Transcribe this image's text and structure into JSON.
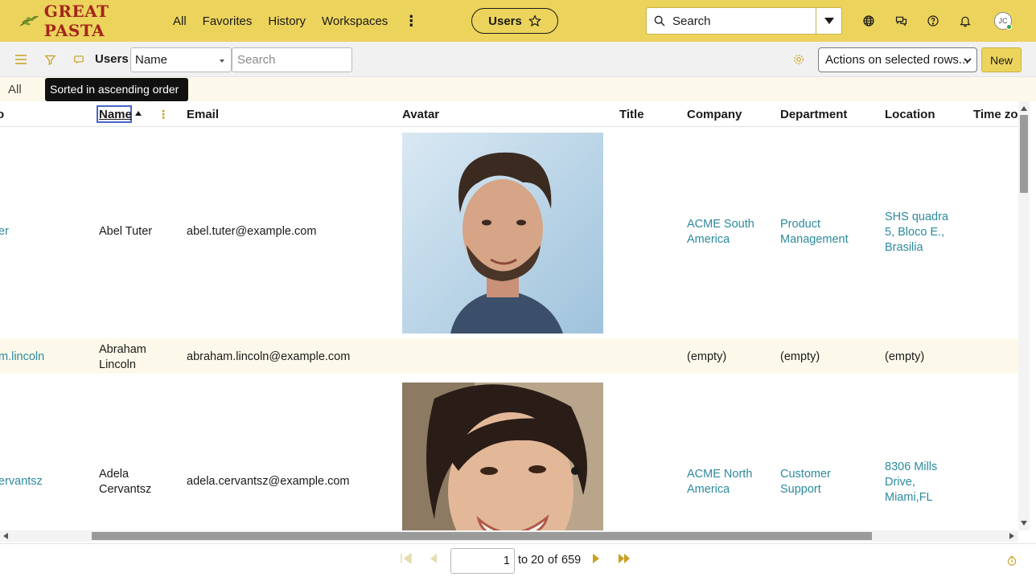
{
  "brand": {
    "name": "GREAT PASTA"
  },
  "nav": {
    "all": "All",
    "favorites": "Favorites",
    "history": "History",
    "workspaces": "Workspaces"
  },
  "context_pill": {
    "label": "Users"
  },
  "global_search": {
    "placeholder": "Search"
  },
  "user_avatar": {
    "initials": "JC"
  },
  "toolbar": {
    "title": "Users",
    "field_select": "Name",
    "search_placeholder": "Search",
    "actions_select": "Actions on selected rows...",
    "new_label": "New"
  },
  "filter": {
    "breadcrumb": "All"
  },
  "tooltip": {
    "text": "Sorted in ascending order"
  },
  "columns": [
    "Name",
    "Email",
    "Avatar",
    "Title",
    "Company",
    "Department",
    "Location",
    "Time zo"
  ],
  "rows": [
    {
      "user_id": "er",
      "name": "Abel Tuter",
      "email": "abel.tuter@example.com",
      "title": "",
      "company": "ACME South America",
      "department": "Product Management",
      "location": "SHS quadra 5, Bloco E., Brasilia"
    },
    {
      "user_id": "m.lincoln",
      "name": "Abraham Lincoln",
      "email": "abraham.lincoln@example.com",
      "title": "",
      "company": "(empty)",
      "department": "(empty)",
      "location": "(empty)"
    },
    {
      "user_id": "ervantsz",
      "name": "Adela Cervantsz",
      "email": "adela.cervantsz@example.com",
      "title": "",
      "company": "ACME North America",
      "department": "Customer Support",
      "location": "8306 Mills Drive, Miami,FL"
    }
  ],
  "pager": {
    "current": "1",
    "to": "to",
    "end": "20",
    "of": "of",
    "total": "659"
  },
  "colors": {
    "brand_bar": "#ecd35c",
    "link": "#2b8a9c",
    "row_alt": "#fdf9ea",
    "brand_red": "#a3261c"
  }
}
